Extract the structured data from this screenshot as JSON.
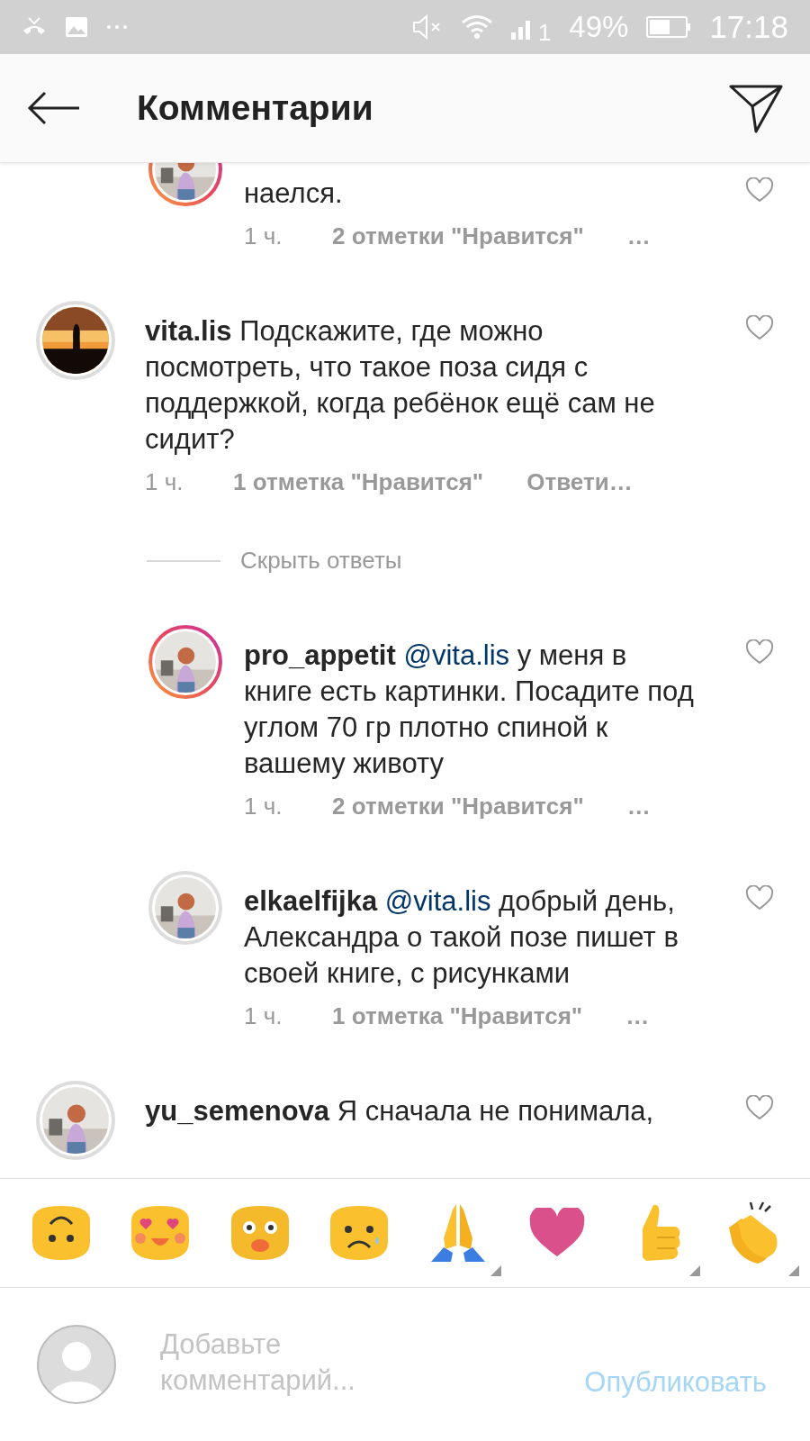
{
  "status_bar": {
    "battery_text": "49%",
    "sim_index": "1",
    "time": "17:18"
  },
  "header": {
    "title": "Комментарии"
  },
  "comments": [
    {
      "kind": "reply",
      "clipped": true,
      "story_ring": true,
      "text": "наелся.",
      "time": "1 ч.",
      "likes": "2 отметки \"Нравится\"",
      "action": "…"
    },
    {
      "kind": "top",
      "clipped": false,
      "story_ring": false,
      "username": "vita.lis",
      "text": "Подскажите, где можно посмотреть, что такое поза сидя с поддержкой, когда ребёнок ещё сам не сидит?",
      "time": "1 ч.",
      "likes": "1 отметка \"Нравится\"",
      "action": "Ответи…"
    },
    {
      "kind": "toggle",
      "label": "Скрыть ответы"
    },
    {
      "kind": "reply",
      "clipped": false,
      "story_ring": true,
      "username": "pro_appetit",
      "mention": "@vita.lis",
      "text": "у меня в книге есть картинки. Посадите под углом 70 гр плотно спиной к вашему животу",
      "time": "1 ч.",
      "likes": "2 отметки \"Нравится\"",
      "action": "…"
    },
    {
      "kind": "reply",
      "clipped": false,
      "story_ring": false,
      "username": "elkaelfijka",
      "mention": "@vita.lis",
      "text": "добрый день, Александра о такой позе пишет в своей книге, с рисунками",
      "time": "1 ч.",
      "likes": "1 отметка \"Нравится\"",
      "action": "…"
    },
    {
      "kind": "top",
      "clipped": false,
      "story_ring": false,
      "username": "yu_semenova",
      "text": "Я сначала не понимала,"
    }
  ],
  "emojis": [
    {
      "kind": "upside-down",
      "variants": false
    },
    {
      "kind": "heart-eyes",
      "variants": false
    },
    {
      "kind": "fearful",
      "variants": false
    },
    {
      "kind": "sad",
      "variants": false
    },
    {
      "kind": "folded-hands",
      "variants": true
    },
    {
      "kind": "heart",
      "variants": false
    },
    {
      "kind": "thumbs-up",
      "variants": true
    },
    {
      "kind": "clap",
      "variants": true
    }
  ],
  "composer": {
    "placeholder": "Добавьте комментарий...",
    "publish": "Опубликовать"
  }
}
